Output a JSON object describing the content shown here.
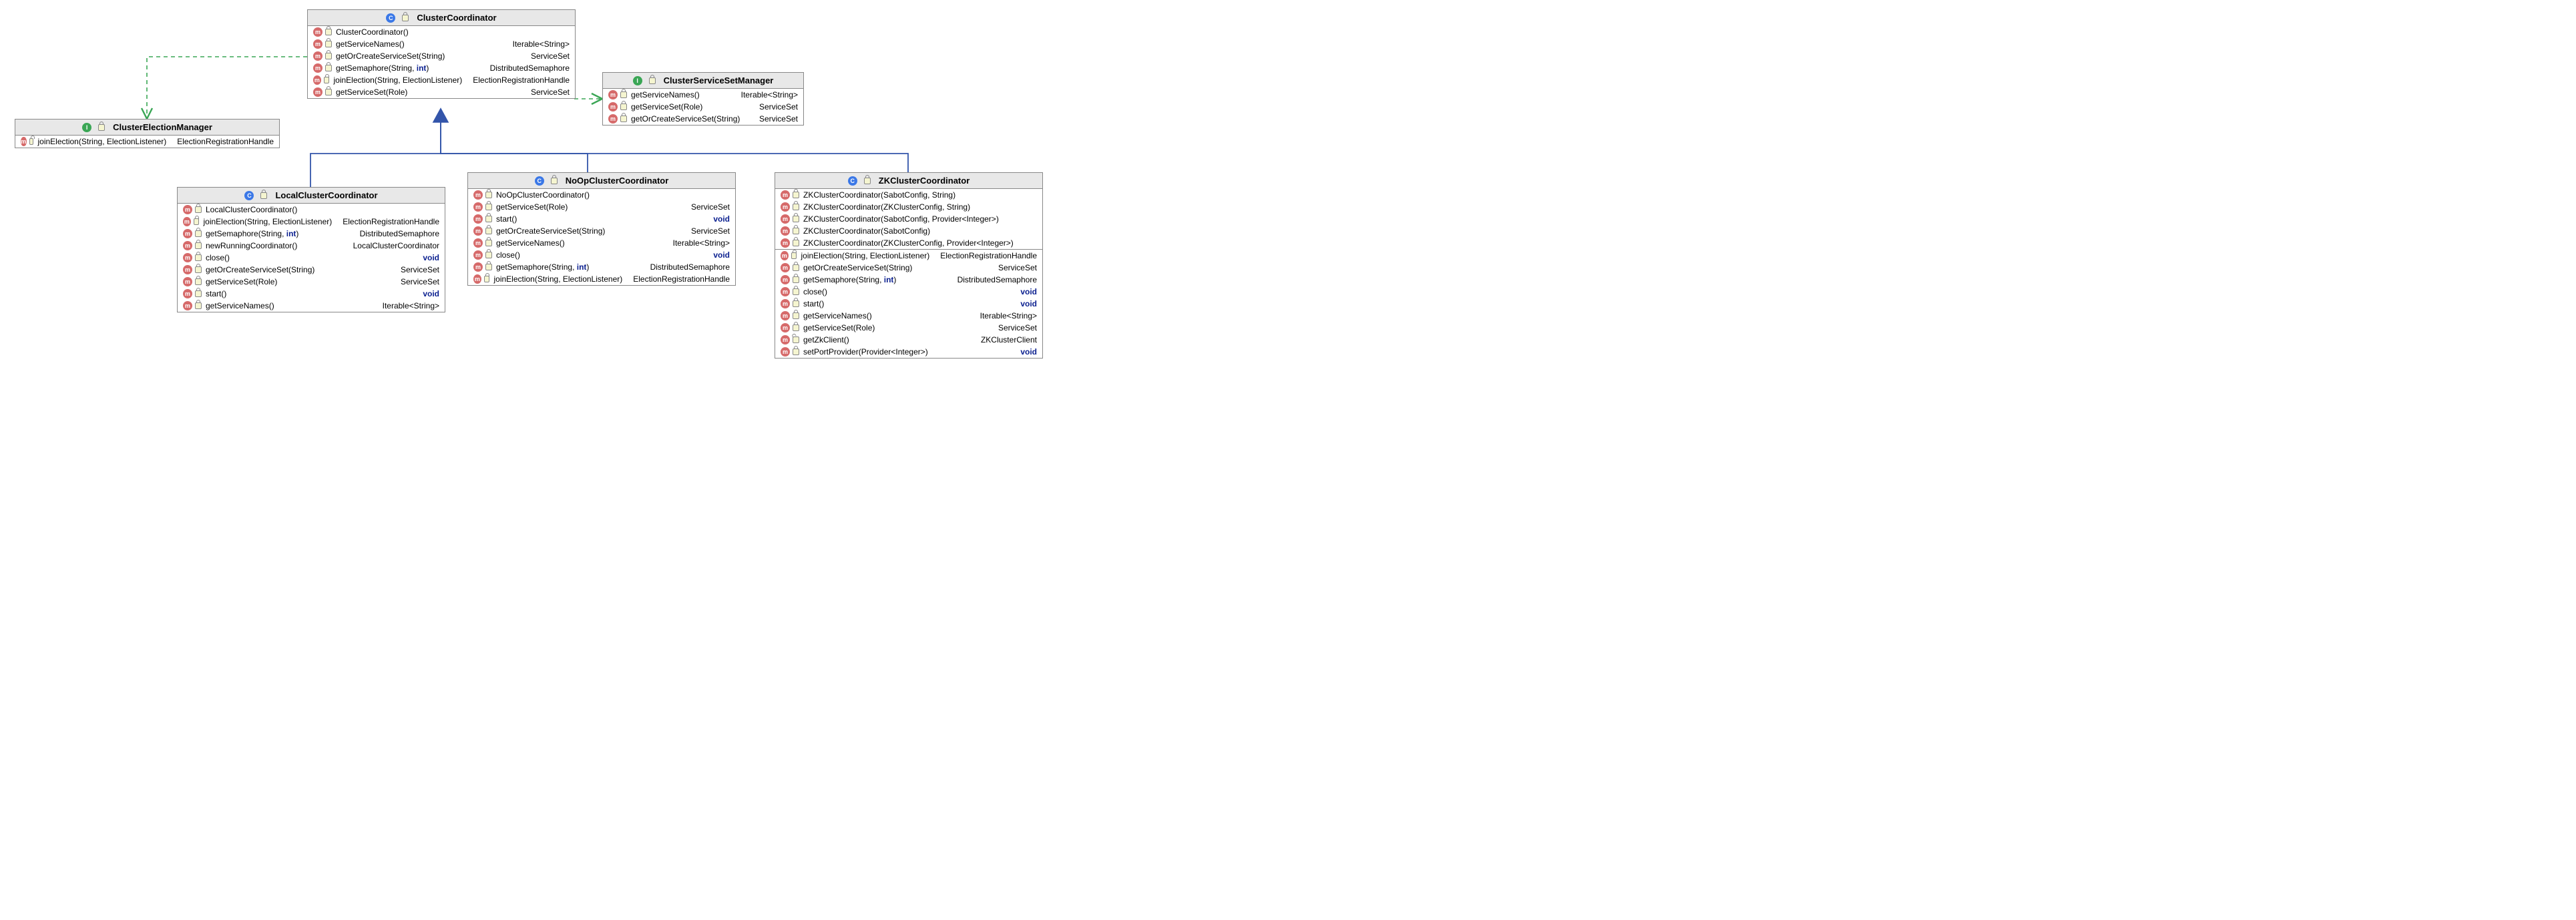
{
  "classes": {
    "clusterCoordinator": {
      "title": "ClusterCoordinator",
      "kind": "C",
      "methods": [
        {
          "sig": "ClusterCoordinator()",
          "ret": ""
        },
        {
          "sig": "getServiceNames()",
          "ret": "Iterable<String>"
        },
        {
          "sig": "getOrCreateServiceSet(String)",
          "ret": "ServiceSet"
        },
        {
          "sig_pre": "getSemaphore(String, ",
          "sig_kw": "int",
          "sig_post": ")",
          "ret": "DistributedSemaphore"
        },
        {
          "sig": "joinElection(String, ElectionListener)",
          "ret": "ElectionRegistrationHandle"
        },
        {
          "sig": "getServiceSet(Role)",
          "ret": "ServiceSet"
        }
      ]
    },
    "clusterElectionManager": {
      "title": "ClusterElectionManager",
      "kind": "I",
      "methods": [
        {
          "sig": "joinElection(String, ElectionListener)",
          "ret": "ElectionRegistrationHandle"
        }
      ]
    },
    "clusterServiceSetManager": {
      "title": "ClusterServiceSetManager",
      "kind": "I",
      "methods": [
        {
          "sig": "getServiceNames()",
          "ret": "Iterable<String>"
        },
        {
          "sig": "getServiceSet(Role)",
          "ret": "ServiceSet"
        },
        {
          "sig": "getOrCreateServiceSet(String)",
          "ret": "ServiceSet"
        }
      ]
    },
    "localClusterCoordinator": {
      "title": "LocalClusterCoordinator",
      "kind": "C",
      "methods": [
        {
          "sig": "LocalClusterCoordinator()",
          "ret": ""
        },
        {
          "sig": "joinElection(String, ElectionListener)",
          "ret": "ElectionRegistrationHandle"
        },
        {
          "sig_pre": "getSemaphore(String, ",
          "sig_kw": "int",
          "sig_post": ")",
          "ret": "DistributedSemaphore"
        },
        {
          "sig": "newRunningCoordinator()",
          "ret": "LocalClusterCoordinator"
        },
        {
          "sig": "close()",
          "ret_void": "void"
        },
        {
          "sig": "getOrCreateServiceSet(String)",
          "ret": "ServiceSet"
        },
        {
          "sig": "getServiceSet(Role)",
          "ret": "ServiceSet"
        },
        {
          "sig": "start()",
          "ret_void": "void"
        },
        {
          "sig": "getServiceNames()",
          "ret": "Iterable<String>"
        }
      ]
    },
    "noOpClusterCoordinator": {
      "title": "NoOpClusterCoordinator",
      "kind": "C",
      "methods": [
        {
          "sig": "NoOpClusterCoordinator()",
          "ret": ""
        },
        {
          "sig": "getServiceSet(Role)",
          "ret": "ServiceSet"
        },
        {
          "sig": "start()",
          "ret_void": "void"
        },
        {
          "sig": "getOrCreateServiceSet(String)",
          "ret": "ServiceSet"
        },
        {
          "sig": "getServiceNames()",
          "ret": "Iterable<String>"
        },
        {
          "sig": "close()",
          "ret_void": "void"
        },
        {
          "sig_pre": "getSemaphore(String, ",
          "sig_kw": "int",
          "sig_post": ")",
          "ret": "DistributedSemaphore"
        },
        {
          "sig": "joinElection(String, ElectionListener)",
          "ret": "ElectionRegistrationHandle"
        }
      ]
    },
    "zkClusterCoordinator": {
      "title": "ZKClusterCoordinator",
      "kind": "C",
      "constructors": [
        {
          "sig": "ZKClusterCoordinator(SabotConfig, String)"
        },
        {
          "sig": "ZKClusterCoordinator(ZKClusterConfig, String)"
        },
        {
          "sig": "ZKClusterCoordinator(SabotConfig, Provider<Integer>)"
        },
        {
          "sig": "ZKClusterCoordinator(SabotConfig)"
        },
        {
          "sig": "ZKClusterCoordinator(ZKClusterConfig, Provider<Integer>)"
        }
      ],
      "methods": [
        {
          "sig": "joinElection(String, ElectionListener)",
          "ret": "ElectionRegistrationHandle"
        },
        {
          "sig": "getOrCreateServiceSet(String)",
          "ret": "ServiceSet"
        },
        {
          "sig_pre": "getSemaphore(String, ",
          "sig_kw": "int",
          "sig_post": ")",
          "ret": "DistributedSemaphore"
        },
        {
          "sig": "close()",
          "ret_void": "void"
        },
        {
          "sig": "start()",
          "ret_void": "void"
        },
        {
          "sig": "getServiceNames()",
          "ret": "Iterable<String>"
        },
        {
          "sig": "getServiceSet(Role)",
          "ret": "ServiceSet"
        },
        {
          "sig": "getZkClient()",
          "ret": "ZKClusterClient",
          "package": true
        },
        {
          "sig": "setPortProvider(Provider<Integer>)",
          "ret_void": "void"
        }
      ]
    }
  }
}
